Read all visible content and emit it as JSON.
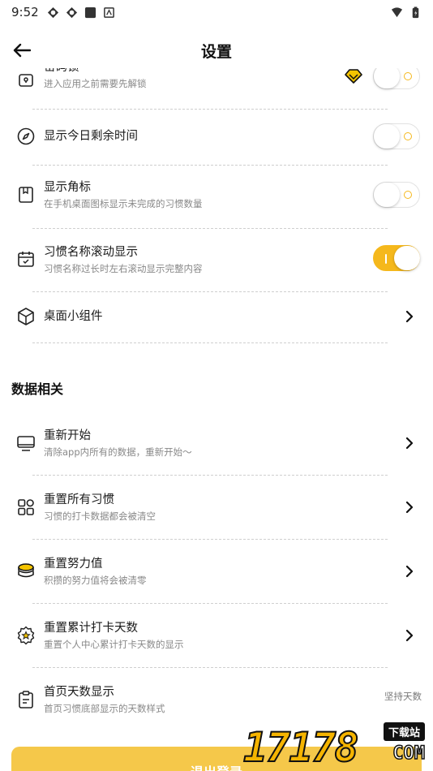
{
  "status_bar": {
    "time": "9:52"
  },
  "header": {
    "title": "设置"
  },
  "settings": {
    "app_lock": {
      "title": "密码锁",
      "subtitle": "进入应用之前需要先解锁"
    },
    "show_remaining_time": {
      "title": "显示今日剩余时间"
    },
    "show_badge": {
      "title": "显示角标",
      "subtitle": "在手机桌面图标显示未完成的习惯数量"
    },
    "scroll_habit_name": {
      "title": "习惯名称滚动显示",
      "subtitle": "习惯名称过长时左右滚动显示完整内容"
    },
    "desktop_widget": {
      "title": "桌面小组件"
    }
  },
  "data_section": {
    "title": "数据相关",
    "restart": {
      "title": "重新开始",
      "subtitle": "清除app内所有的数据，重新开始～"
    },
    "reset_habits": {
      "title": "重置所有习惯",
      "subtitle": "习惯的打卡数据都会被清空"
    },
    "reset_effort": {
      "title": "重置努力值",
      "subtitle": "积攒的努力值将会被清零"
    },
    "reset_checkin_days": {
      "title": "重置累计打卡天数",
      "subtitle": "重置个人中心累计打卡天数的显示"
    },
    "home_days_display": {
      "title": "首页天数显示",
      "subtitle": "首页习惯底部显示的天数样式",
      "value": "坚持天数"
    }
  },
  "logout": {
    "label": "退出登录"
  },
  "watermark": {
    "number": "17178",
    "badge": "下载站",
    "suffix": "COM"
  },
  "toggles": {
    "app_lock": false,
    "show_remaining_time": false,
    "show_badge": false,
    "scroll_habit_name": true
  },
  "colors": {
    "accent": "#f5b81c",
    "logout_bg": "#f5c84a"
  }
}
